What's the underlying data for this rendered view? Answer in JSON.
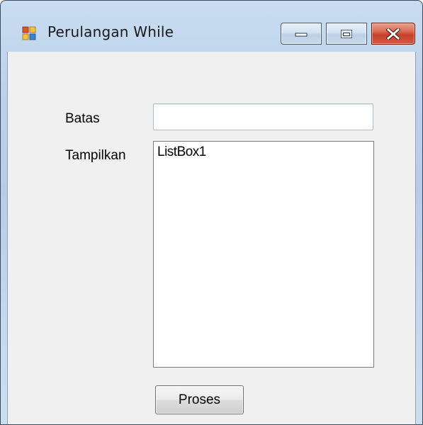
{
  "window": {
    "title": "Perulangan While",
    "controls": {
      "minimize": "minimize-icon",
      "maximize": "maximize-icon",
      "close": "close-icon"
    }
  },
  "form": {
    "batas_label": "Batas",
    "batas_value": "",
    "tampilkan_label": "Tampilkan",
    "listbox_items": [
      "ListBox1"
    ],
    "proses_button": "Proses"
  },
  "colors": {
    "close_button": "#c7402a",
    "client_background": "#f0f0f0",
    "titlebar_glass": "#bcd3ec"
  }
}
